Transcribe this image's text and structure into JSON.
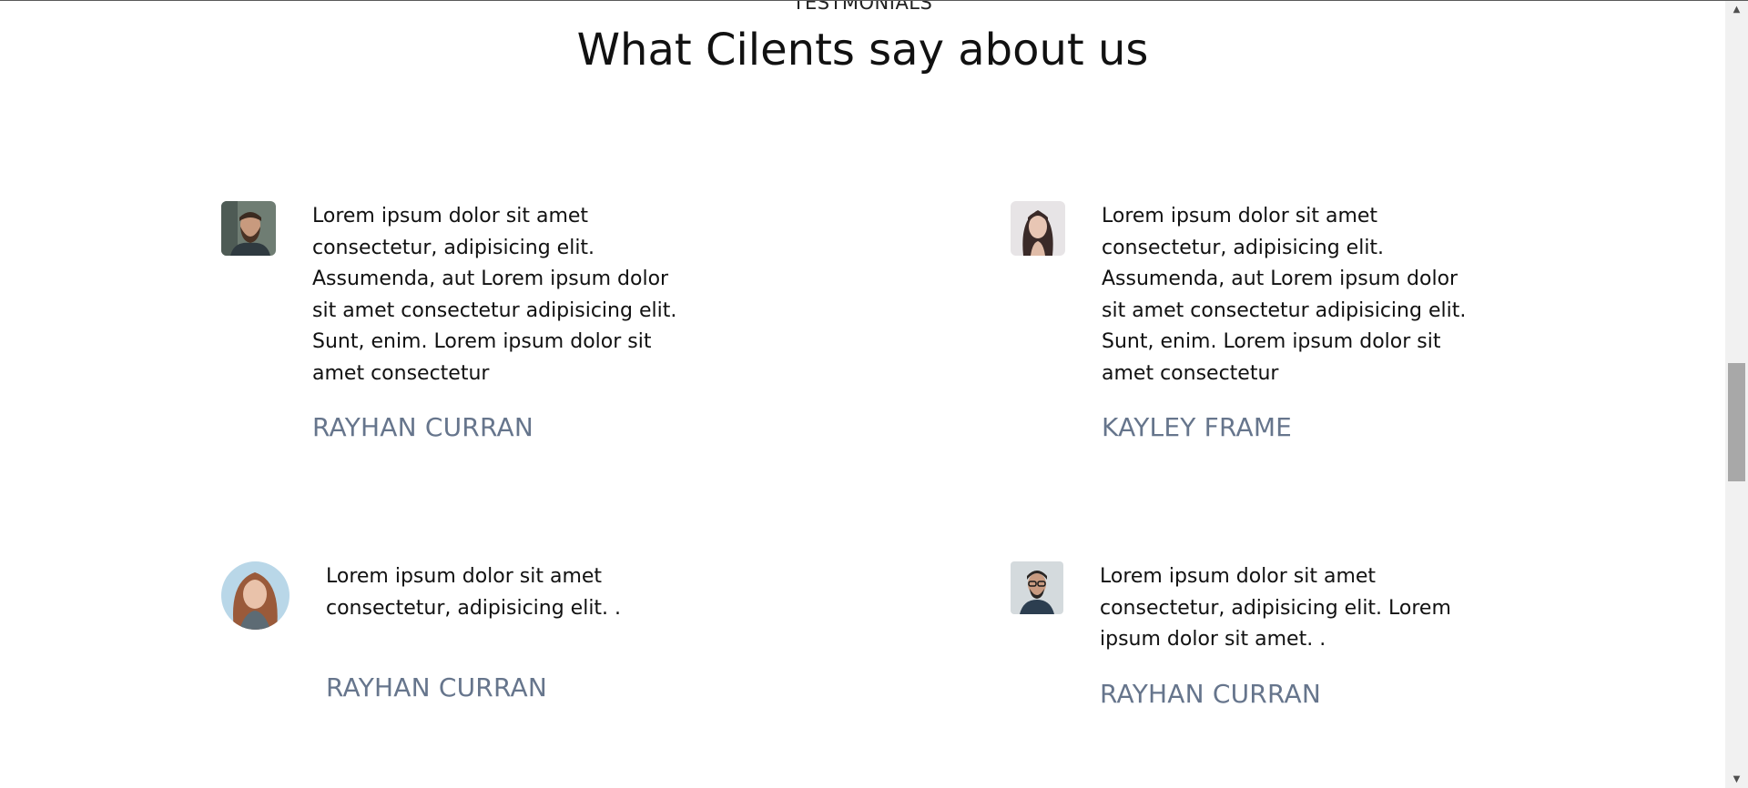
{
  "section": {
    "kicker": "TESTMONIALS",
    "title": "What Cilents say about us"
  },
  "testimonials": [
    {
      "avatar_icon": "bearded-man-avatar",
      "quote": "Lorem ipsum dolor sit amet consectetur, adipisicing elit. Assumenda, aut Lorem ipsum dolor sit amet consectetur adipisicing elit. Sunt, enim. Lorem ipsum dolor sit amet consectetur",
      "name": "RAYHAN CURRAN"
    },
    {
      "avatar_icon": "woman-long-hair-avatar",
      "quote": "Lorem ipsum dolor sit amet consectetur, adipisicing elit. Assumenda, aut Lorem ipsum dolor sit amet consectetur adipisicing elit. Sunt, enim. Lorem ipsum dolor sit amet consectetur",
      "name": "KAYLEY FRAME"
    },
    {
      "avatar_icon": "red-haired-woman-avatar",
      "quote": "Lorem ipsum dolor sit amet consectetur, adipisicing elit. .",
      "name": "RAYHAN CURRAN"
    },
    {
      "avatar_icon": "man-with-glasses-avatar",
      "quote": "Lorem ipsum dolor sit amet consectetur, adipisicing elit. Lorem ipsum dolor sit amet. .",
      "name": "RAYHAN CURRAN"
    }
  ],
  "colors": {
    "name_text": "#66758c",
    "title_text": "#111111",
    "scrollbar_thumb": "#a8a8a8",
    "scrollbar_track": "#f1f1f1"
  }
}
